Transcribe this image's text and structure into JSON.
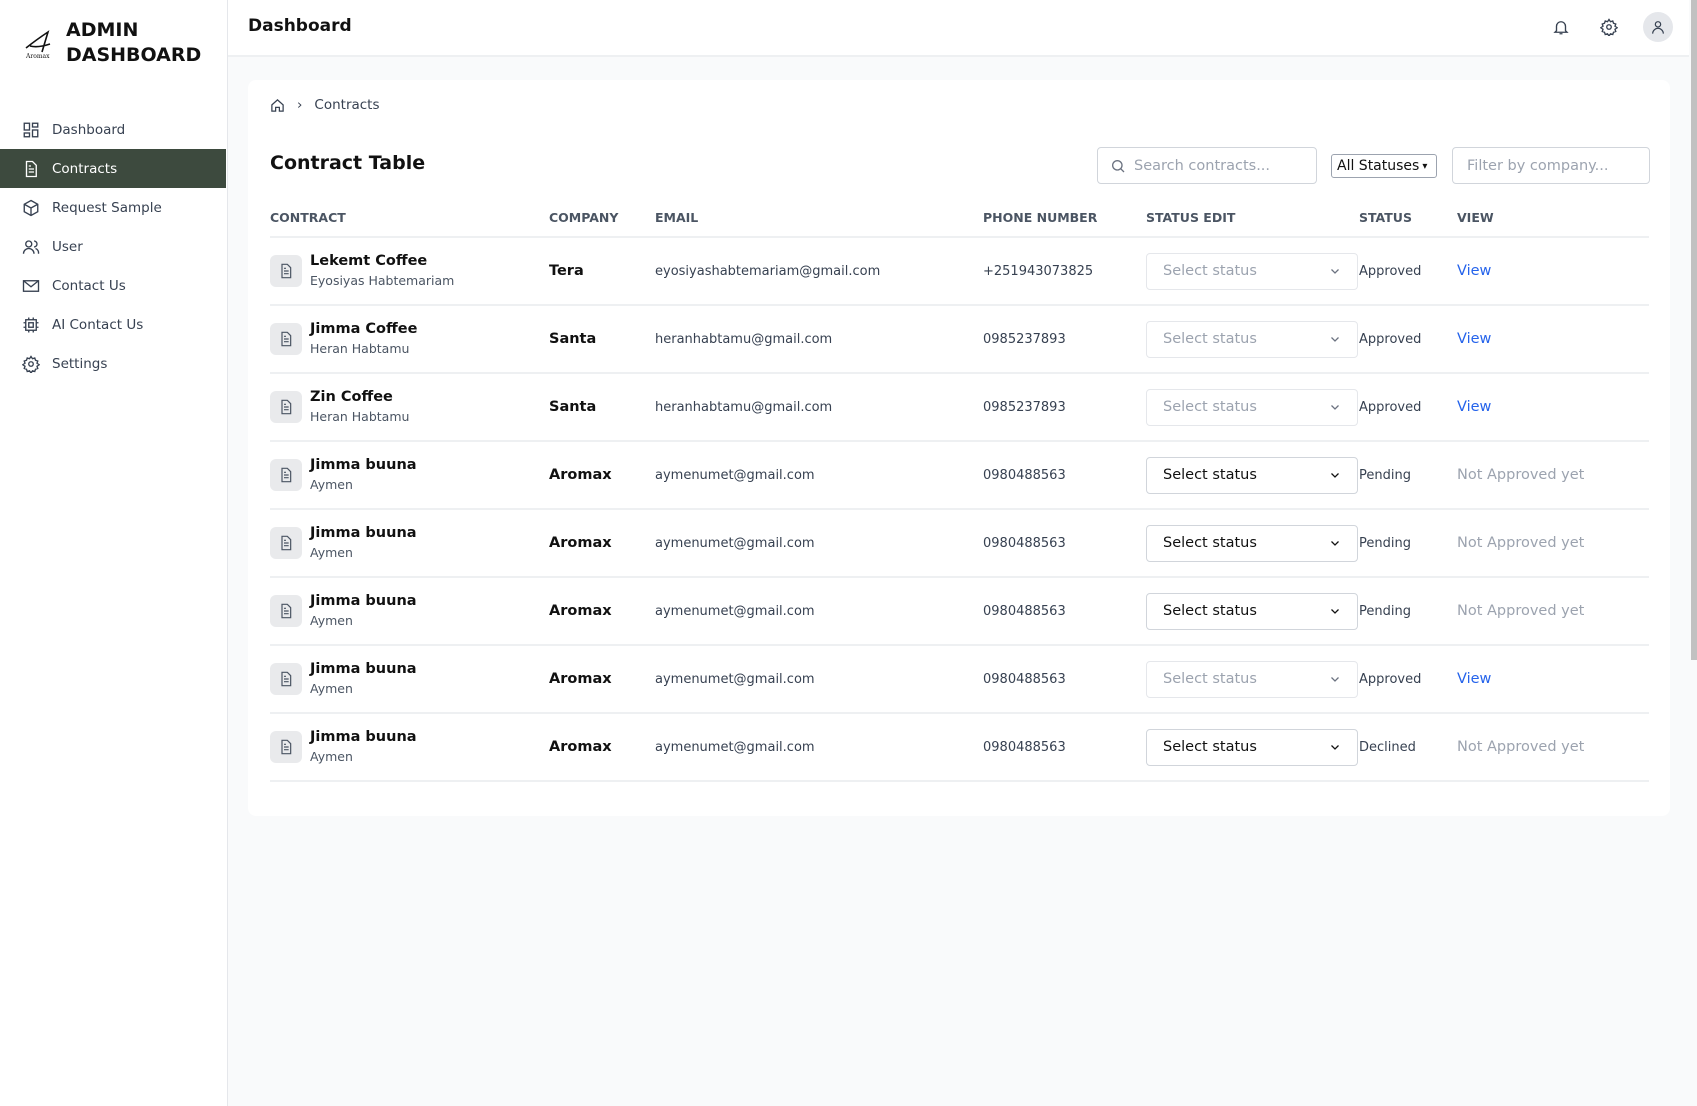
{
  "brand": {
    "title_line1": "ADMIN",
    "title_line2": "DASHBOARD",
    "logo_text": "Aromax"
  },
  "sidebar": {
    "items": [
      {
        "label": "Dashboard",
        "icon": "grid-icon"
      },
      {
        "label": "Contracts",
        "icon": "document-icon"
      },
      {
        "label": "Request Sample",
        "icon": "box-icon"
      },
      {
        "label": "User",
        "icon": "users-icon"
      },
      {
        "label": "Contact Us",
        "icon": "mail-icon"
      },
      {
        "label": "AI Contact Us",
        "icon": "chip-icon"
      },
      {
        "label": "Settings",
        "icon": "gear-icon"
      }
    ],
    "active": "Contracts"
  },
  "header": {
    "title": "Dashboard"
  },
  "breadcrumb": {
    "current": "Contracts"
  },
  "page": {
    "title": "Contract Table",
    "search_placeholder": "Search contracts...",
    "status_filter": "All Statuses",
    "company_placeholder": "Filter by company..."
  },
  "table": {
    "columns": [
      "CONTRACT",
      "COMPANY",
      "EMAIL",
      "PHONE NUMBER",
      "STATUS EDIT",
      "STATUS",
      "VIEW"
    ],
    "rows": [
      {
        "name": "Lekemt Coffee",
        "person": "Eyosiyas Habtemariam",
        "company": "Tera",
        "email": "eyosiyashabtemariam@gmail.com",
        "phone": "+251943073825",
        "select": "Select status",
        "status": "Approved",
        "view": "View"
      },
      {
        "name": "Jimma Coffee",
        "person": "Heran Habtamu",
        "company": "Santa",
        "email": "heranhabtamu@gmail.com",
        "phone": "0985237893",
        "select": "Select status",
        "status": "Approved",
        "view": "View"
      },
      {
        "name": "Zin Coffee",
        "person": "Heran Habtamu",
        "company": "Santa",
        "email": "heranhabtamu@gmail.com",
        "phone": "0985237893",
        "select": "Select status",
        "status": "Approved",
        "view": "View"
      },
      {
        "name": "Jimma buuna",
        "person": "Aymen",
        "company": "Aromax",
        "email": "aymenumet@gmail.com",
        "phone": "0980488563",
        "select": "Select status",
        "status": "Pending",
        "view": "Not Approved yet"
      },
      {
        "name": "Jimma buuna",
        "person": "Aymen",
        "company": "Aromax",
        "email": "aymenumet@gmail.com",
        "phone": "0980488563",
        "select": "Select status",
        "status": "Pending",
        "view": "Not Approved yet"
      },
      {
        "name": "Jimma buuna",
        "person": "Aymen",
        "company": "Aromax",
        "email": "aymenumet@gmail.com",
        "phone": "0980488563",
        "select": "Select status",
        "status": "Pending",
        "view": "Not Approved yet"
      },
      {
        "name": "Jimma buuna",
        "person": "Aymen",
        "company": "Aromax",
        "email": "aymenumet@gmail.com",
        "phone": "0980488563",
        "select": "Select status",
        "status": "Approved",
        "view": "View"
      },
      {
        "name": "Jimma buuna",
        "person": "Aymen",
        "company": "Aromax",
        "email": "aymenumet@gmail.com",
        "phone": "0980488563",
        "select": "Select status",
        "status": "Declined",
        "view": "Not Approved yet"
      }
    ]
  },
  "colors": {
    "active_nav": "#3d4a3e",
    "link": "#2563eb"
  }
}
